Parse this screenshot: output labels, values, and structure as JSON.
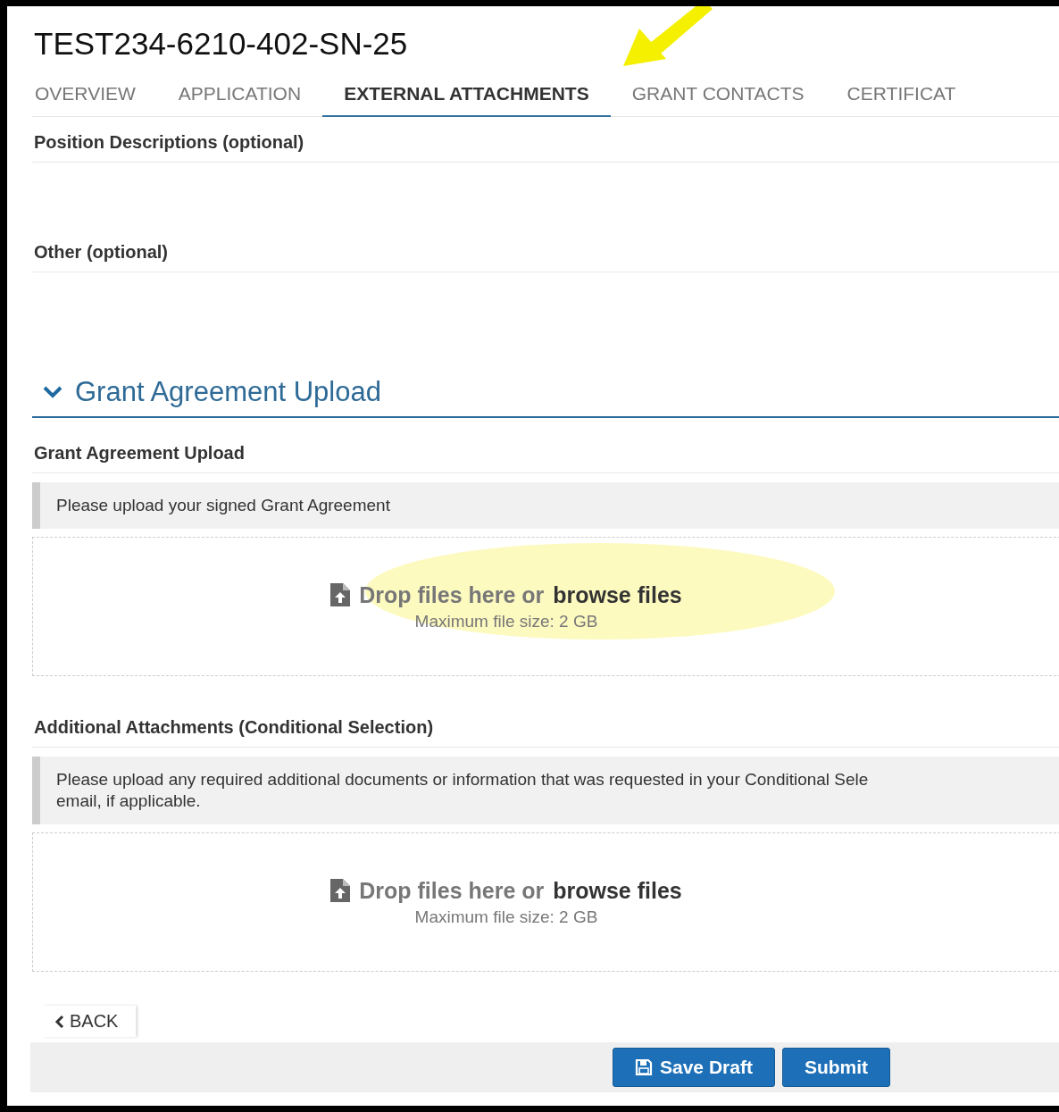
{
  "title": "TEST234-6210-402-SN-25",
  "tabs": [
    {
      "label": "OVERVIEW",
      "selected": false
    },
    {
      "label": "APPLICATION",
      "selected": false
    },
    {
      "label": "EXTERNAL ATTACHMENTS",
      "selected": true
    },
    {
      "label": "GRANT CONTACTS",
      "selected": false
    },
    {
      "label": "CERTIFICAT",
      "selected": false
    }
  ],
  "optional_fields": [
    {
      "label": "Position Descriptions (optional)"
    },
    {
      "label": "Other (optional)"
    }
  ],
  "section": {
    "title": "Grant Agreement Upload",
    "expanded": true,
    "fields": [
      {
        "label": "Grant Agreement Upload",
        "note_lines": [
          "Please upload your signed Grant Agreement"
        ],
        "dropzone": {
          "text": "Drop files here or",
          "link": "browse files",
          "hint": "Maximum file size: 2 GB",
          "highlighted": true
        }
      },
      {
        "label": "Additional Attachments (Conditional Selection)",
        "note_lines": [
          "Please upload any required additional documents or information that was requested in your Conditional Sele",
          "email, if applicable."
        ],
        "dropzone": {
          "text": "Drop files here or",
          "link": "browse files",
          "hint": "Maximum file size: 2 GB",
          "highlighted": false
        }
      }
    ]
  },
  "back_button": "BACK",
  "buttons": [
    {
      "label": "Save Draft",
      "kind": "save"
    },
    {
      "label": "Submit",
      "kind": "submit"
    }
  ]
}
